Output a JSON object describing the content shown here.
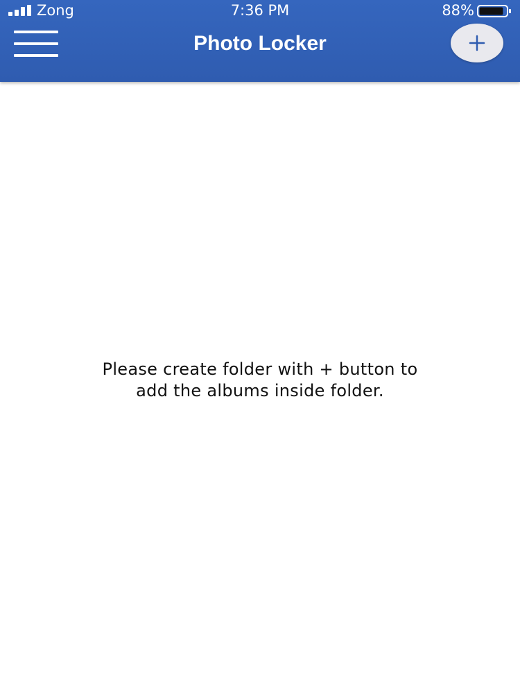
{
  "status_bar": {
    "carrier": "Zong",
    "time": "7:36 PM",
    "battery_percent": "88%",
    "battery_level": 0.88
  },
  "header": {
    "title": "Photo Locker",
    "menu_icon": "hamburger-menu-icon",
    "add_icon": "plus-icon",
    "background_color": "#3063b8"
  },
  "main": {
    "empty_message": "Please create folder with + button to add the albums inside folder."
  }
}
